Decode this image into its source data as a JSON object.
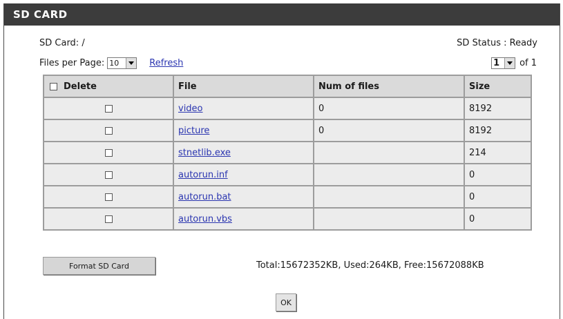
{
  "section": {
    "title": "SD CARD"
  },
  "sd": {
    "card_label": "SD Card: /",
    "status_label": "SD Status : Ready"
  },
  "paging": {
    "files_per_page_label": "Files per Page:",
    "files_per_page_value": "10",
    "refresh_label": "Refresh",
    "page_value": "1",
    "page_total_label": "of 1"
  },
  "table": {
    "headers": {
      "delete": "Delete",
      "file": "File",
      "num": "Num of files",
      "size": "Size"
    },
    "rows": [
      {
        "file": "video",
        "num": "0",
        "size": "8192"
      },
      {
        "file": "picture",
        "num": "0",
        "size": "8192"
      },
      {
        "file": "stnetlib.exe",
        "num": "",
        "size": "214"
      },
      {
        "file": "autorun.inf",
        "num": "",
        "size": "0"
      },
      {
        "file": "autorun.bat",
        "num": "",
        "size": "0"
      },
      {
        "file": "autorun.vbs",
        "num": "",
        "size": "0"
      }
    ]
  },
  "actions": {
    "format_label": "Format SD Card",
    "totals": "Total:15672352KB, Used:264KB, Free:15672088KB",
    "ok_label": "OK"
  }
}
